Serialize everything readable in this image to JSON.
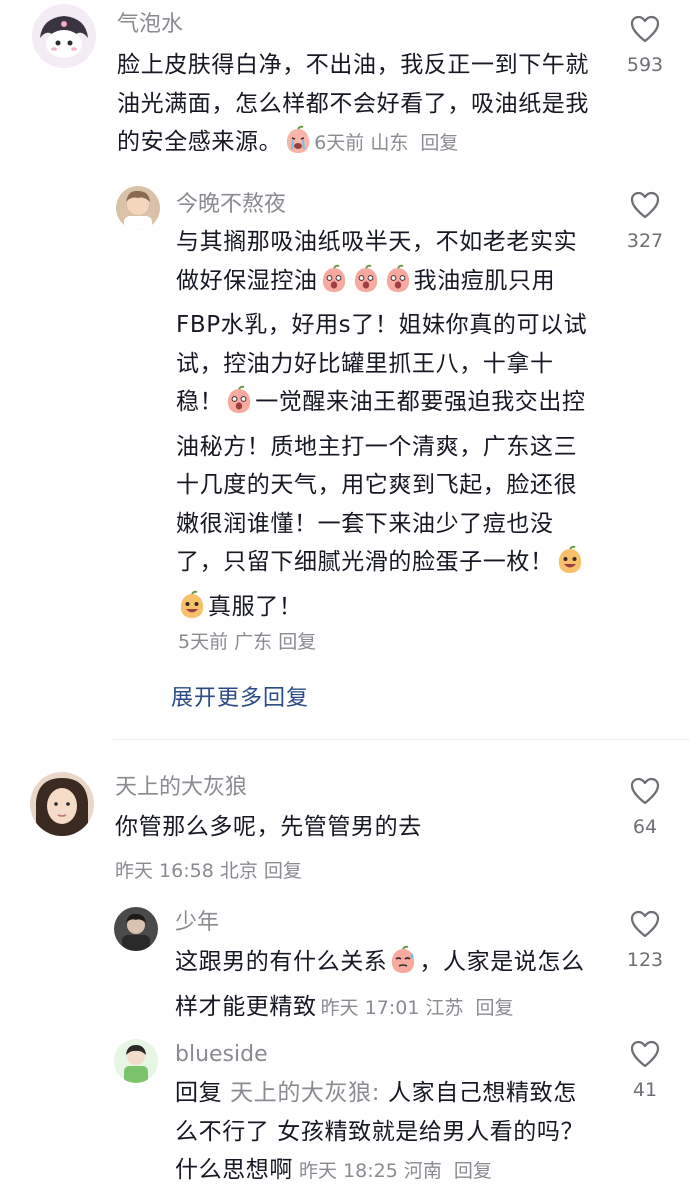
{
  "comments": [
    {
      "name": "气泡水",
      "text": "脸上皮肤得白净，不出油，我反正一到下午就油光满面，怎么样都不会好看了，吸油纸是我的安全感来源。",
      "time": "6天前",
      "location": "山东",
      "reply_label": "回复",
      "likes": "593",
      "replies": [
        {
          "name": "今晚不熬夜",
          "text_a": "与其搁那吸油纸吸半天，不如老老实实做好保湿控油",
          "text_b": "我油痘肌只用FBP水乳，好用s了！姐妹你真的可以试试，控油力好比罐里抓王八，十拿十稳！",
          "text_c": "一觉醒来油王都要强迫我交出控油秘方！质地主打一个清爽，广东这三十几度的天气，用它爽到飞起，脸还很嫩很润谁懂！一套下来油少了痘也没了，只留下细腻光滑的脸蛋子一枚！",
          "text_d": "真服了！",
          "time": "5天前",
          "location": "广东",
          "reply_label": "回复",
          "likes": "327"
        }
      ],
      "expand_label": "展开更多回复"
    },
    {
      "name": "天上的大灰狼",
      "text": "你管那么多呢，先管管男的去",
      "time": "昨天 16:58",
      "location": "北京",
      "reply_label": "回复",
      "likes": "64",
      "replies": [
        {
          "name": "少年",
          "text_a": "这跟男的有什么关系",
          "text_b": "，人家是说怎么样才能更精致",
          "time": "昨天 17:01",
          "location": "江苏",
          "reply_label": "回复",
          "likes": "123"
        },
        {
          "name": "blueside",
          "reply_prefix": "回复",
          "reply_to": "天上的大灰狼:",
          "text": "人家自己想精致怎么不行了 女孩精致就是给男人看的吗？什么思想啊",
          "time": "昨天 18:25",
          "location": "河南",
          "reply_label": "回复",
          "likes": "41"
        }
      ]
    }
  ],
  "icons": {
    "like": "heart-outline-icon",
    "emoji_crying": "peach-crying-emoji",
    "emoji_shocked": "peach-shocked-emoji",
    "emoji_grin": "peach-grin-emoji",
    "emoji_sweat": "peach-sweat-emoji"
  },
  "colors": {
    "text": "#161823",
    "secondary": "#8a8b91",
    "link": "#2b4a86"
  }
}
